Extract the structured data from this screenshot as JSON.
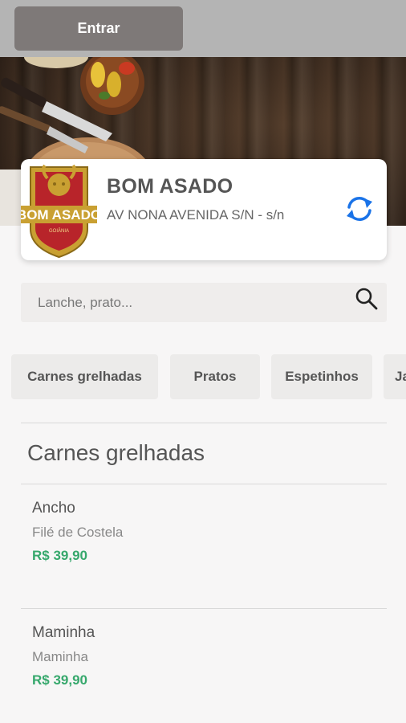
{
  "header": {
    "enter_label": "Entrar"
  },
  "restaurant": {
    "name": "BOM ASADO",
    "address": "AV NONA AVENIDA S/N - s/n",
    "logo_text": "BOM ASADO",
    "logo_subtext": "GOIÂNIA"
  },
  "search": {
    "placeholder": "Lanche, prato..."
  },
  "categories": [
    "Carnes grelhadas",
    "Pratos",
    "Espetinhos",
    "Ja"
  ],
  "section": {
    "title": "Carnes grelhadas"
  },
  "items": [
    {
      "name": "Ancho",
      "description": "Filé de Costela",
      "price": "R$ 39,90"
    },
    {
      "name": "Maminha",
      "description": "Maminha",
      "price": "R$ 39,90"
    }
  ],
  "colors": {
    "price": "#36a86c",
    "refresh_icon": "#1a73e8",
    "topbar": "#b4b4b4",
    "enter_button": "#7e7978"
  },
  "icons": {
    "refresh": "refresh-icon",
    "search": "search-icon"
  }
}
